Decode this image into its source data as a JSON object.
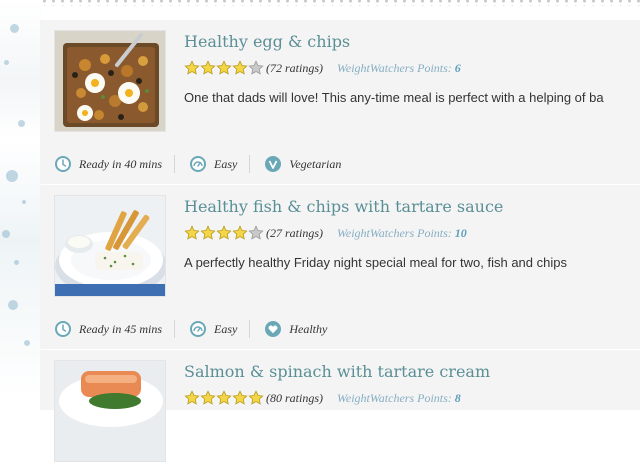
{
  "colors": {
    "title": "#5a8f96",
    "points": "#5f9fbd",
    "card_bg": "#f4f4f4",
    "star_full": "#f2d646",
    "star_empty": "#c9c9c9",
    "icon_teal": "#6aa8b8"
  },
  "recipes": [
    {
      "title": "Healthy egg & chips",
      "rating_stars": 4,
      "ratings": "(72 ratings)",
      "ww_label": "WeightWatchers Points:",
      "ww_points": "6",
      "description": "One that dads will love! This any-time meal is perfect with a helping of ba",
      "info": [
        {
          "icon": "clock-icon",
          "text": "Ready in 40 mins"
        },
        {
          "icon": "difficulty-icon",
          "text": "Easy"
        },
        {
          "icon": "vegetarian-icon",
          "text": "Vegetarian"
        }
      ]
    },
    {
      "title": "Healthy fish & chips with tartare sauce",
      "rating_stars": 4,
      "ratings": "(27 ratings)",
      "ww_label": "WeightWatchers Points:",
      "ww_points": "10",
      "description": "A perfectly healthy Friday night special meal for two, fish and chips",
      "info": [
        {
          "icon": "clock-icon",
          "text": "Ready in 45 mins"
        },
        {
          "icon": "difficulty-icon",
          "text": "Easy"
        },
        {
          "icon": "heart-icon",
          "text": "Healthy"
        }
      ]
    },
    {
      "title": "Salmon & spinach with tartare cream",
      "rating_stars": 5,
      "ratings": "(80 ratings)",
      "ww_label": "WeightWatchers Points:",
      "ww_points": "8"
    }
  ]
}
